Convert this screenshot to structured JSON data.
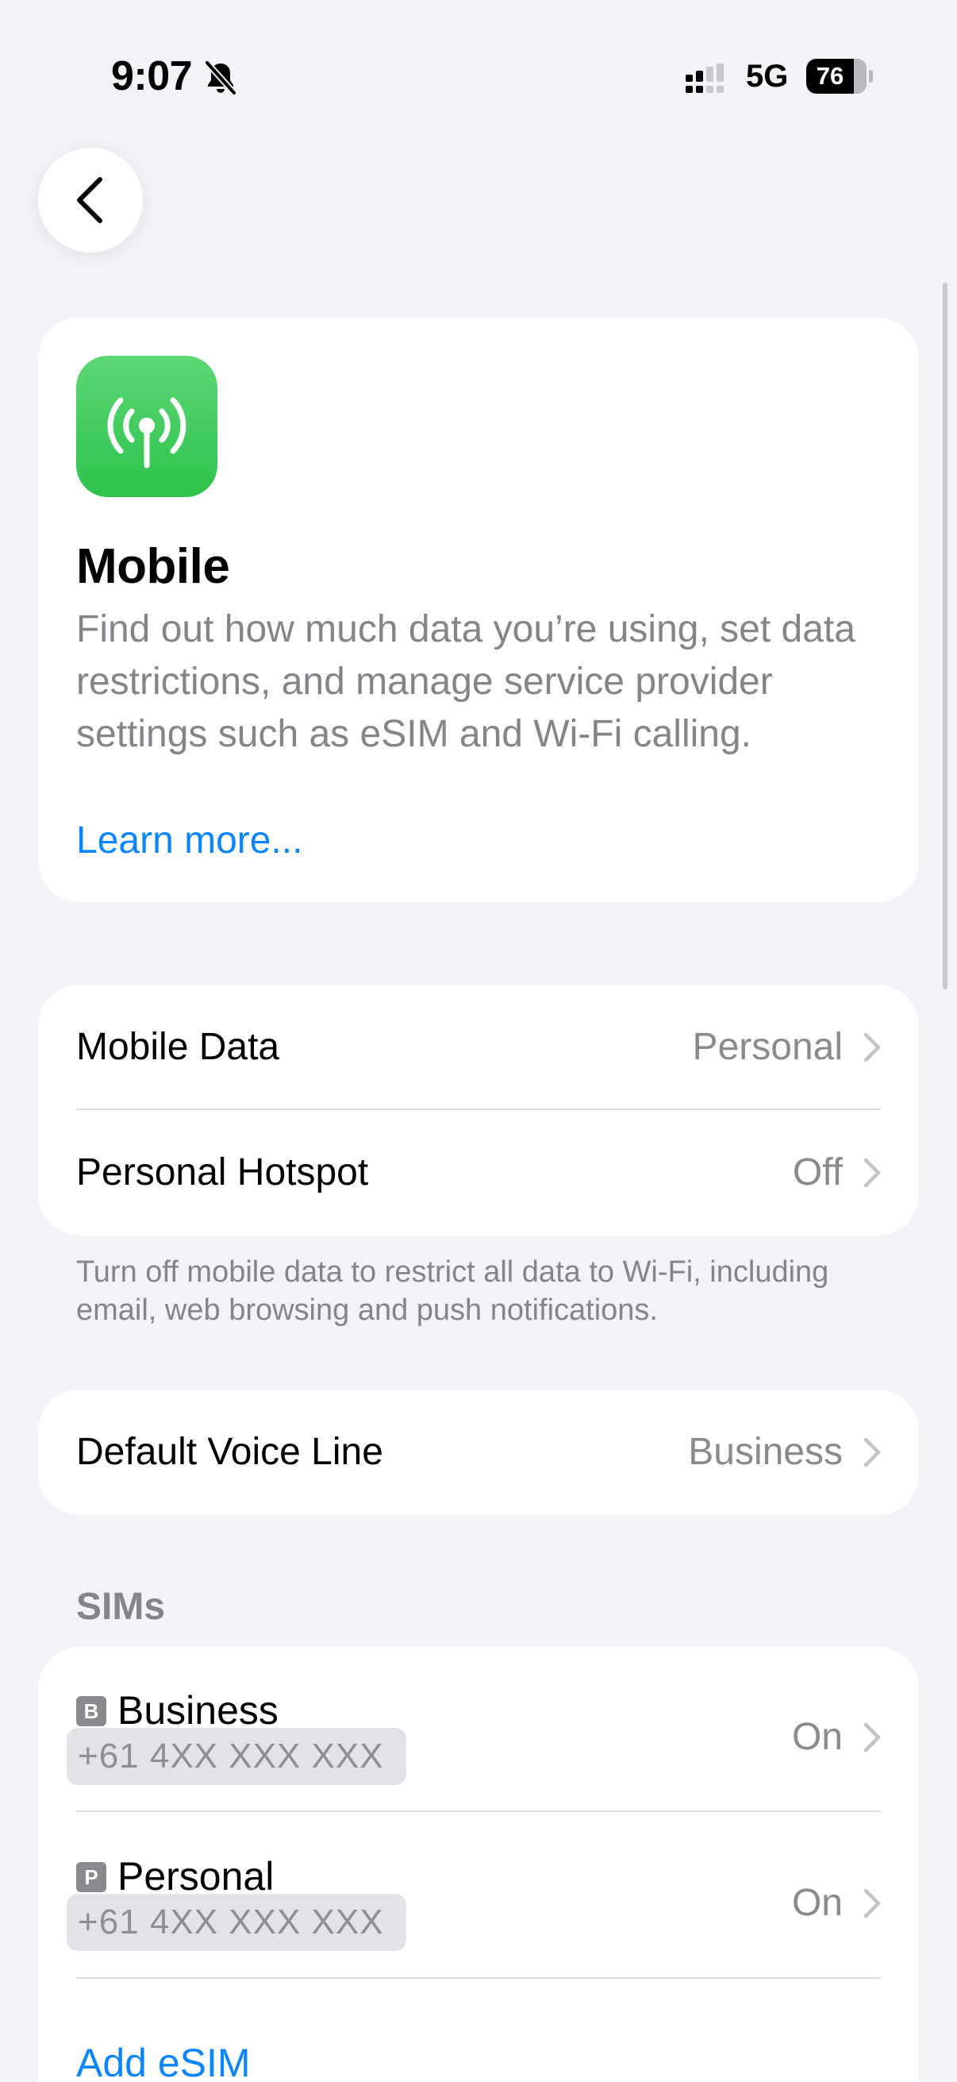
{
  "status_bar": {
    "time": "9:07",
    "network": "5G",
    "battery_level": "76",
    "bell_icon": "bell-slash-icon",
    "signal_icon": "dual-sim-signal-icon"
  },
  "nav": {
    "back_icon": "chevron-left-icon"
  },
  "header": {
    "icon": "antenna-radiowaves-icon",
    "icon_color": "#34c759",
    "title": "Mobile",
    "description": "Find out how much data you’re using, set data restrictions, and manage service provider settings such as eSIM and Wi-Fi calling.",
    "learn_more": "Learn more..."
  },
  "data_section": {
    "rows": [
      {
        "label": "Mobile Data",
        "value": "Personal"
      },
      {
        "label": "Personal Hotspot",
        "value": "Off"
      }
    ],
    "footer": "Turn off mobile data to restrict all data to Wi-Fi, including email, web browsing and push notifications."
  },
  "voice_section": {
    "label": "Default Voice Line",
    "value": "Business"
  },
  "sims_section": {
    "header": "SIMs",
    "sims": [
      {
        "badge": "B",
        "name": "Business",
        "number": "+61 4XX XXX XXX",
        "status": "On"
      },
      {
        "badge": "P",
        "name": "Personal",
        "number": "+61 4XX XXX XXX",
        "status": "On"
      }
    ],
    "add_esim": "Add eSIM"
  },
  "colors": {
    "background": "#f2f2f7",
    "accent_link": "#0a84ff",
    "secondary_text": "#8a8a8e"
  }
}
